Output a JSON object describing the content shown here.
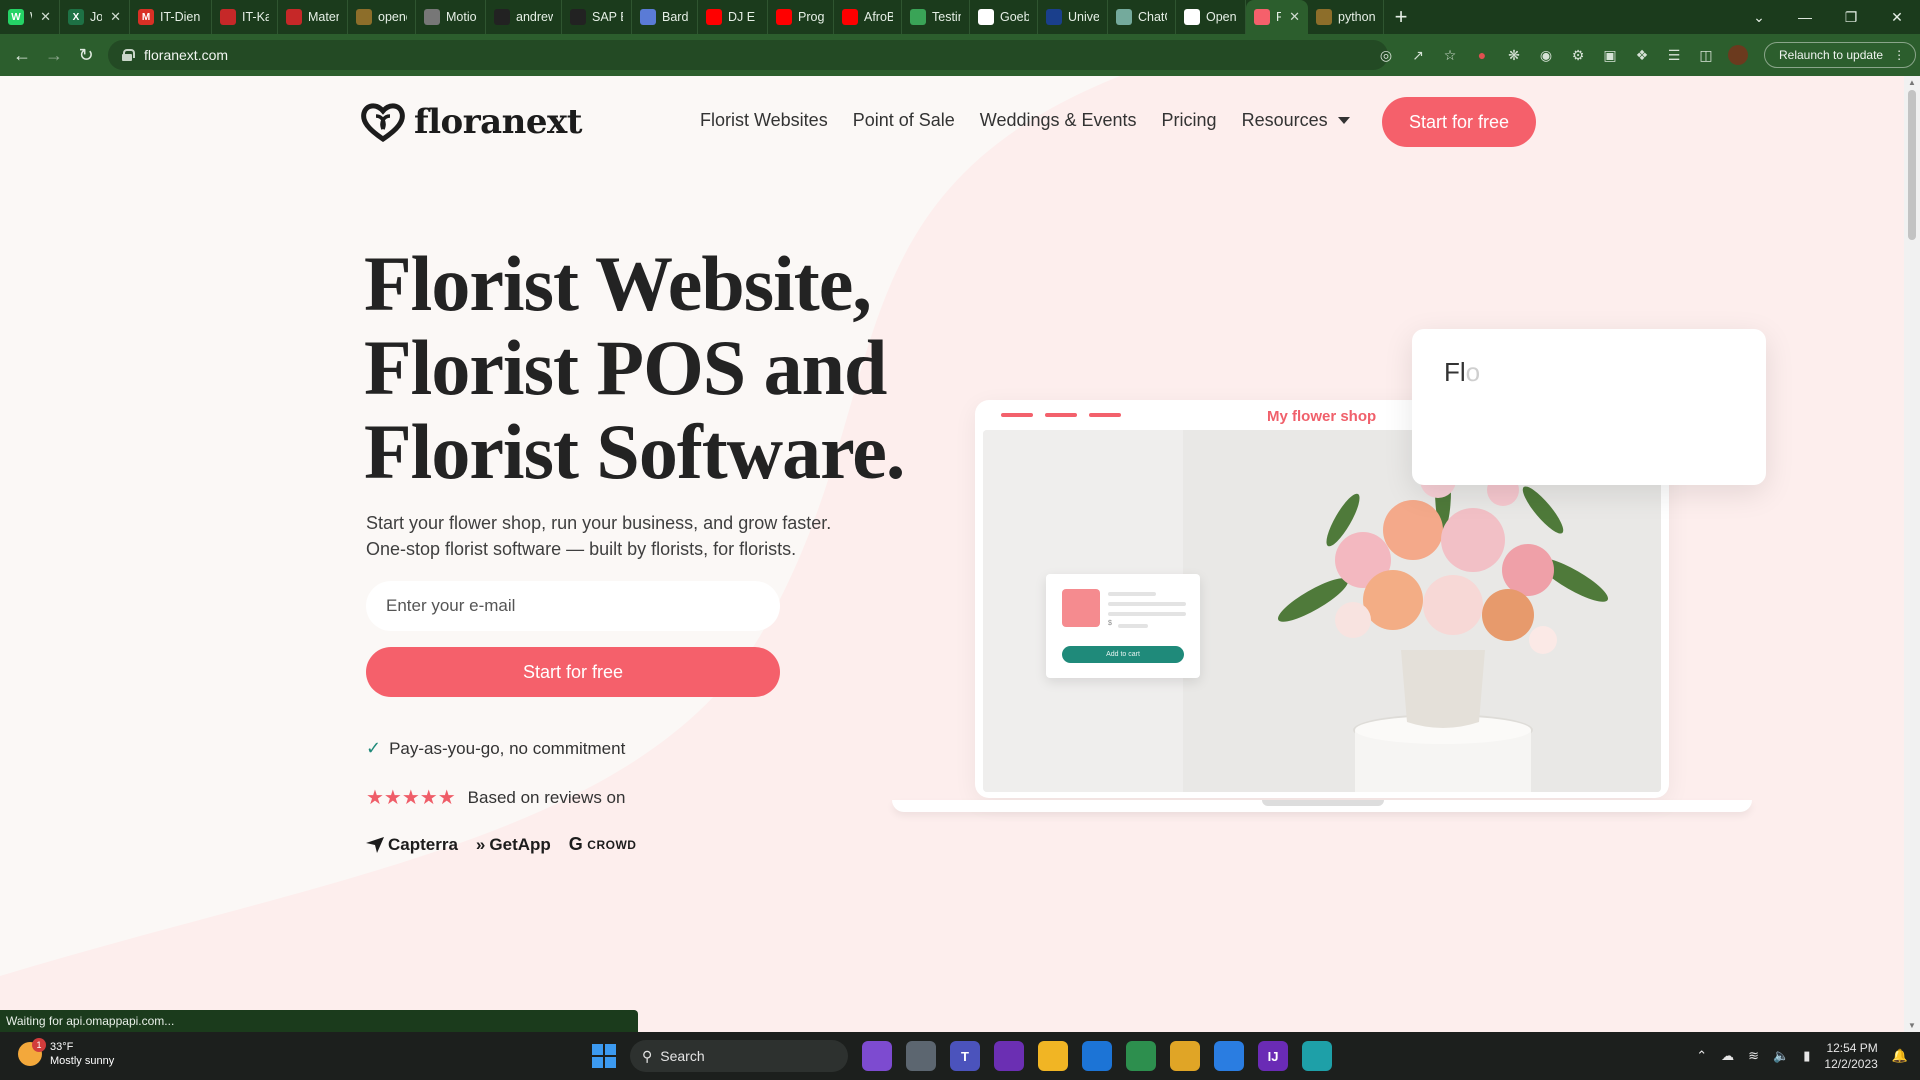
{
  "browser": {
    "tabs": [
      {
        "label": "WI",
        "color": "#25d366",
        "glyph": "W",
        "closable": true
      },
      {
        "label": "Jo",
        "color": "#1e7145",
        "glyph": "X",
        "closable": true
      },
      {
        "label": "IT-Dien",
        "color": "#d93025",
        "glyph": "M",
        "closable": false
      },
      {
        "label": "IT-Karri",
        "color": "#c62828",
        "glyph": "",
        "closable": false
      },
      {
        "label": "Matern",
        "color": "#c62828",
        "glyph": "",
        "closable": false
      },
      {
        "label": "opencv",
        "color": "#8d6e2a",
        "glyph": "",
        "closable": false
      },
      {
        "label": "Motion",
        "color": "#777777",
        "glyph": "",
        "closable": false
      },
      {
        "label": "andrew",
        "color": "#222222",
        "glyph": "",
        "closable": false
      },
      {
        "label": "SAP BI",
        "color": "#222222",
        "glyph": "",
        "closable": false
      },
      {
        "label": "Bard",
        "color": "#5a7bd6",
        "glyph": "",
        "closable": false
      },
      {
        "label": "DJ E",
        "color": "#ff0000",
        "glyph": "",
        "closable": false
      },
      {
        "label": "Progran",
        "color": "#ff0000",
        "glyph": "",
        "closable": false
      },
      {
        "label": "AfroBo",
        "color": "#ff0000",
        "glyph": "",
        "closable": false
      },
      {
        "label": "Testing",
        "color": "#3aa457",
        "glyph": "",
        "closable": false
      },
      {
        "label": "Goebel",
        "color": "#ffffff",
        "glyph": "G",
        "closable": false
      },
      {
        "label": "Univers",
        "color": "#1a3f8c",
        "glyph": "",
        "closable": false
      },
      {
        "label": "ChatGP",
        "color": "#74aa9c",
        "glyph": "",
        "closable": false
      },
      {
        "label": "OpenC",
        "color": "#ffffff",
        "glyph": "",
        "closable": false
      },
      {
        "label": "Flo",
        "color": "#f5606b",
        "glyph": "",
        "closable": true,
        "active": true
      },
      {
        "label": "python",
        "color": "#8d6e2a",
        "glyph": "",
        "closable": false
      }
    ],
    "new_tab_label": "+",
    "url": "floranext.com",
    "relaunch_label": "Relaunch to update",
    "status_text": "Waiting for api.omappapi.com..."
  },
  "site": {
    "brand": "floranext",
    "nav": [
      "Florist Websites",
      "Point of Sale",
      "Weddings & Events",
      "Pricing",
      "Resources"
    ],
    "cta_top": "Start for free",
    "headline": [
      "Florist Website,",
      "Florist POS and",
      "Florist Software."
    ],
    "subhead": [
      "Start your flower shop, run your business, and grow faster.",
      "One-stop florist software — built by florists, for florists."
    ],
    "email_placeholder": "Enter your e-mail",
    "cta_main": "Start for free",
    "benefit": "Pay-as-you-go, no commitment",
    "stars": "★★★★★",
    "reviews_label": "Based on reviews on",
    "review_sites": [
      "Capterra",
      "GetApp",
      "CROWD"
    ],
    "mockup": {
      "shop_title": "My flower shop",
      "add_to_cart": "Add to cart",
      "price_symbol": "$",
      "search_typed": "Fl",
      "search_ghost": "o"
    }
  },
  "taskbar": {
    "temperature": "33°F",
    "weather": "Mostly sunny",
    "search_label": "Search",
    "time": "12:54 PM",
    "date": "12/2/2023"
  }
}
